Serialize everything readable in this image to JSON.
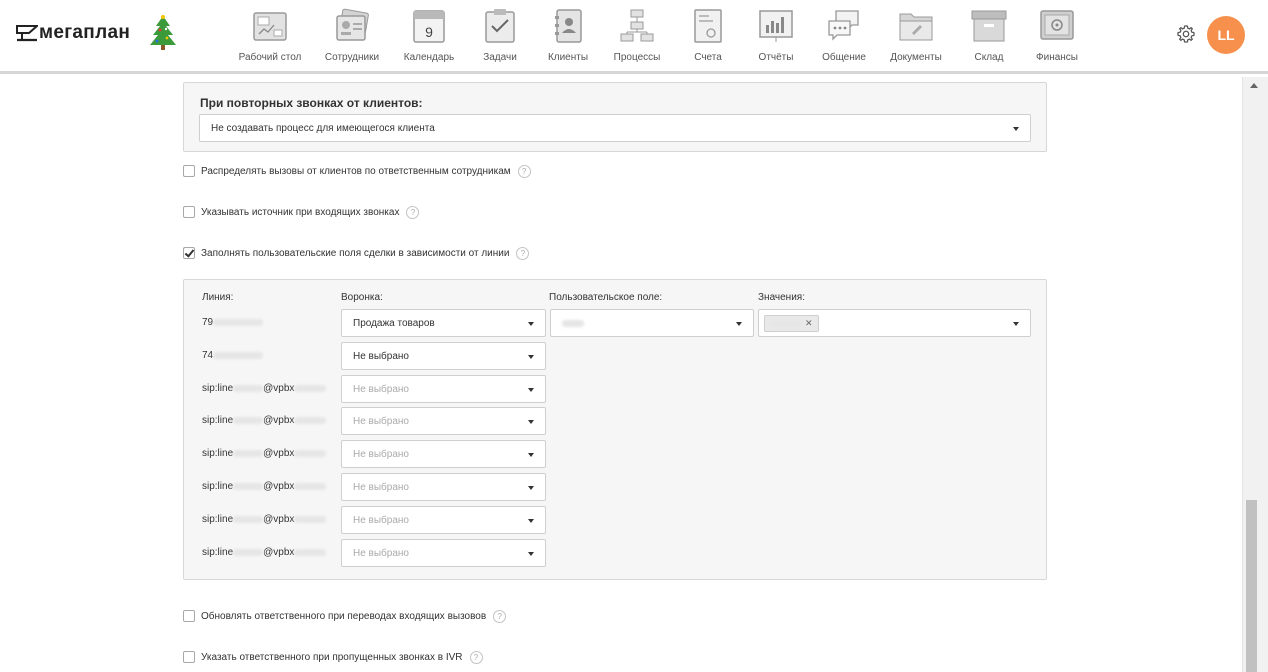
{
  "header": {
    "logo_text": "мегаплан",
    "nav": [
      {
        "label": "Рабочий стол",
        "icon": "desktop-icon"
      },
      {
        "label": "Сотрудники",
        "icon": "employees-icon"
      },
      {
        "label": "Календарь",
        "icon": "calendar-icon",
        "day": "9"
      },
      {
        "label": "Задачи",
        "icon": "tasks-icon"
      },
      {
        "label": "Клиенты",
        "icon": "clients-icon"
      },
      {
        "label": "Процессы",
        "icon": "processes-icon"
      },
      {
        "label": "Счета",
        "icon": "invoices-icon"
      },
      {
        "label": "Отчёты",
        "icon": "reports-icon"
      },
      {
        "label": "Общение",
        "icon": "chat-icon"
      },
      {
        "label": "Документы",
        "icon": "documents-icon"
      },
      {
        "label": "Склад",
        "icon": "warehouse-icon"
      },
      {
        "label": "Финансы",
        "icon": "finance-icon"
      }
    ],
    "avatar_initials": "LL",
    "avatar_color": "#f7904d"
  },
  "repeat_calls": {
    "title": "При повторных звонках от клиентов:",
    "selected": "Не создавать процесс для имеющегося клиента"
  },
  "options": {
    "distribute_calls": {
      "label": "Распределять вызовы от клиентов по ответственным сотрудникам",
      "checked": false
    },
    "show_source": {
      "label": "Указывать источник при входящих звонках",
      "checked": false
    },
    "fill_custom_fields": {
      "label": "Заполнять пользовательские поля сделки в зависимости от линии",
      "checked": true
    },
    "update_responsible": {
      "label": "Обновлять ответственного при переводах входящих вызовов",
      "checked": false
    },
    "ivr_responsible": {
      "label": "Указать ответственного при пропущенных звонках в IVR",
      "checked": false
    }
  },
  "help_glyph": "?",
  "lines_table": {
    "headers": {
      "line": "Линия:",
      "funnel": "Воронка:",
      "custom_field": "Пользовательское поле:",
      "values": "Значения:"
    },
    "rows": [
      {
        "line_prefix": "79",
        "line_suffix": "",
        "funnel": "Продажа товаров",
        "funnel_placeholder": false,
        "has_field": true
      },
      {
        "line_prefix": "74",
        "line_suffix": "",
        "funnel": "Не выбрано",
        "funnel_placeholder": false,
        "has_field": false
      },
      {
        "line_prefix": "sip:line",
        "line_suffix": "@vpbx",
        "funnel": "Не выбрано",
        "funnel_placeholder": true,
        "has_field": false
      },
      {
        "line_prefix": "sip:line",
        "line_suffix": "@vpbx",
        "funnel": "Не выбрано",
        "funnel_placeholder": true,
        "has_field": false
      },
      {
        "line_prefix": "sip:line",
        "line_suffix": "@vpbx",
        "funnel": "Не выбрано",
        "funnel_placeholder": true,
        "has_field": false
      },
      {
        "line_prefix": "sip:line",
        "line_suffix": "@vpbx",
        "funnel": "Не выбрано",
        "funnel_placeholder": true,
        "has_field": false
      },
      {
        "line_prefix": "sip:line",
        "line_suffix": "@vpbx",
        "funnel": "Не выбрано",
        "funnel_placeholder": true,
        "has_field": false
      },
      {
        "line_prefix": "sip:line",
        "line_suffix": "@vpbx",
        "funnel": "Не выбрано",
        "funnel_placeholder": true,
        "has_field": false
      }
    ],
    "tag_close_glyph": "✕"
  }
}
